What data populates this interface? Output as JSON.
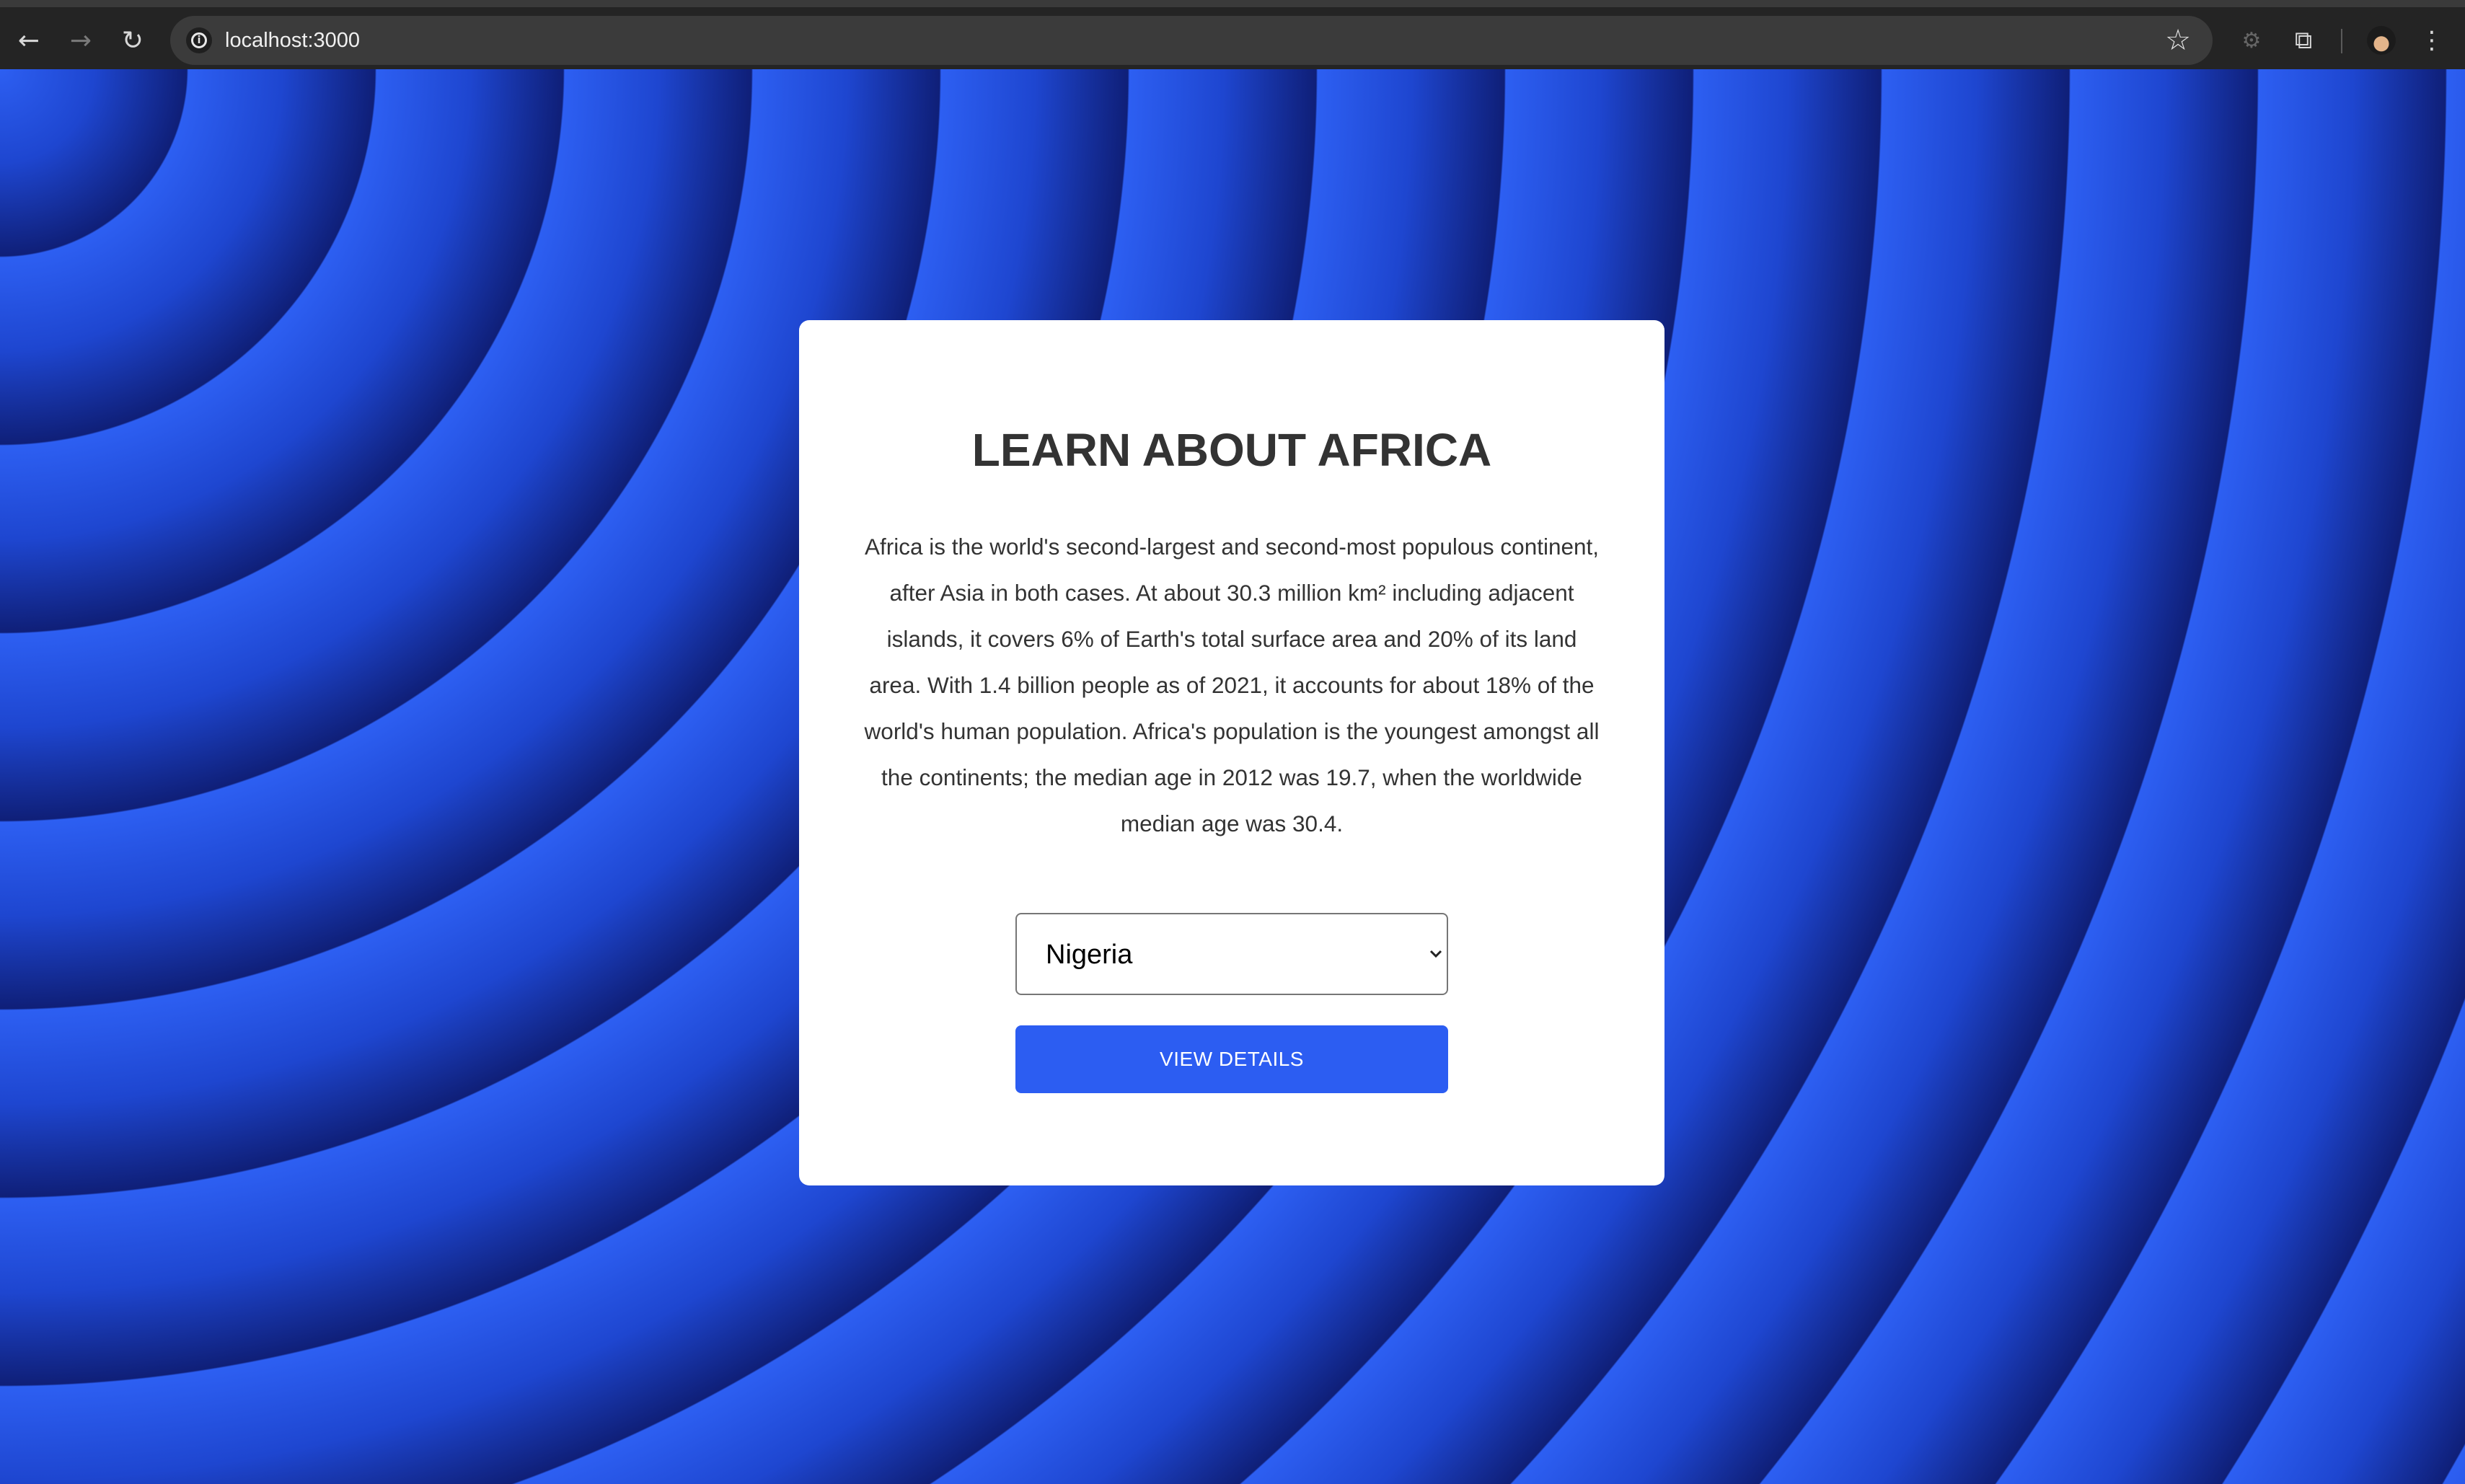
{
  "browser": {
    "url": "localhost:3000",
    "icons": {
      "back": "arrow-left-icon",
      "forward": "arrow-right-icon",
      "reload": "reload-icon",
      "site_info": "info-icon",
      "bookmark": "star-icon",
      "extension": "puzzle-icon",
      "menu": "kebab-menu-icon"
    }
  },
  "card": {
    "title": "LEARN ABOUT AFRICA",
    "description": "Africa is the world's second-largest and second-most populous continent, after Asia in both cases. At about 30.3 million km² including adjacent islands, it covers 6% of Earth's total surface area and 20% of its land area. With 1.4 billion people as of 2021, it accounts for about 18% of the world's human population. Africa's population is the youngest amongst all the continents; the median age in 2012 was 19.7, when the worldwide median age was 30.4.",
    "country_select": {
      "selected": "Nigeria"
    },
    "button_label": "VIEW DETAILS"
  },
  "colors": {
    "accent": "#2c5df2",
    "background_light": "#2d5ff2",
    "background_dark": "#0f1f78",
    "card": "#ffffff",
    "text": "#333333"
  }
}
